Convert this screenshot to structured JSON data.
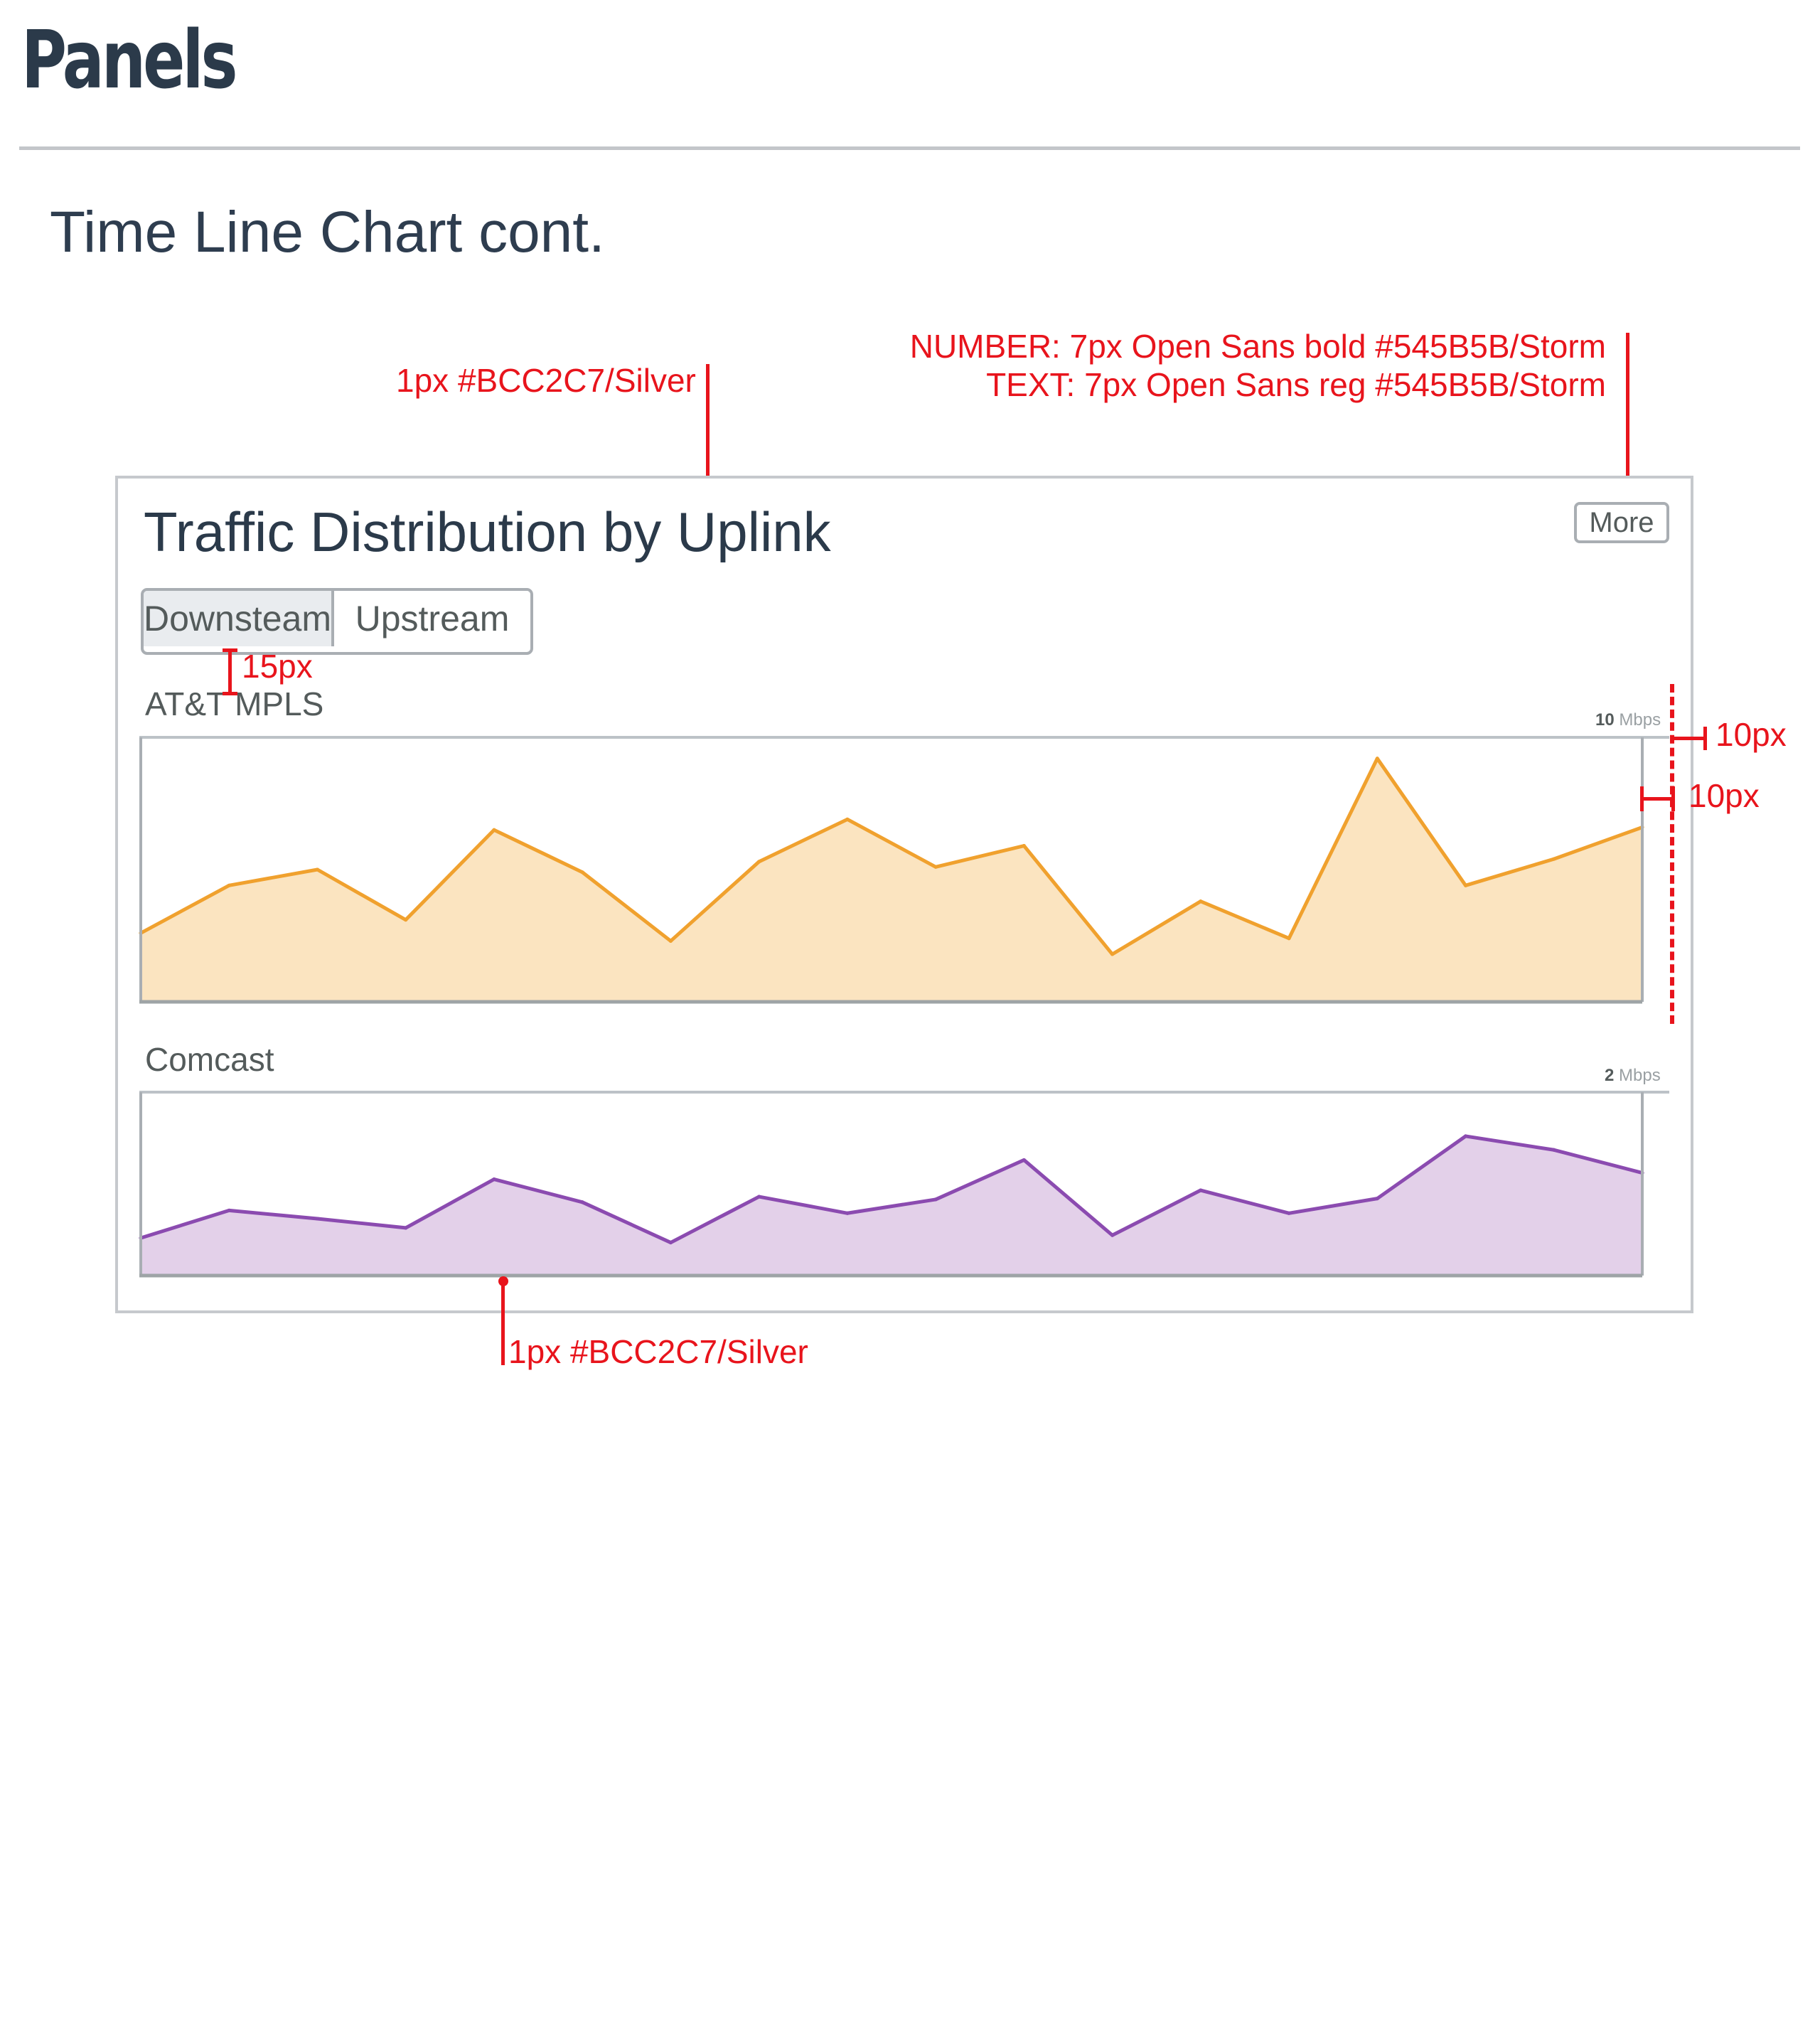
{
  "page": {
    "title": "Panels",
    "section_title": "Time Line Chart cont."
  },
  "panel": {
    "title": "Traffic Distribution by Uplink",
    "more_label": "More",
    "tabs": [
      {
        "label": "Downsteam",
        "active": true
      },
      {
        "label": "Upstream",
        "active": false
      }
    ]
  },
  "annotations": {
    "border_top": "1px #BCC2C7/Silver",
    "number_spec": "NUMBER: 7px Open Sans bold #545B5B/Storm",
    "text_spec": "TEXT: 7px Open Sans reg #545B5B/Storm",
    "spacing_label": "15px",
    "right_padding": "10px",
    "right_margin": "10px",
    "border_bottom": "1px #BCC2C7/Silver"
  },
  "colors": {
    "silver": "#BCC2C7",
    "storm": "#545B5B",
    "annotation": "#E8141C",
    "att_line": "#F0A12E",
    "att_fill": "#FBE4C0",
    "comcast_line": "#8B4BB0",
    "comcast_fill": "#E3D0E9"
  },
  "chart_data": [
    {
      "type": "area",
      "title": "AT&T MPLS",
      "scale_number": "10",
      "scale_unit": "Mbps",
      "ylim": [
        0,
        10
      ],
      "x": [
        0,
        1,
        2,
        3,
        4,
        5,
        6,
        7,
        8,
        9,
        10,
        11,
        12,
        13,
        14,
        15,
        16,
        17
      ],
      "values": [
        2.6,
        4.4,
        5.0,
        3.1,
        6.5,
        4.9,
        2.3,
        5.3,
        6.9,
        5.1,
        5.9,
        1.8,
        3.8,
        2.4,
        9.2,
        4.4,
        5.4,
        6.6
      ],
      "series": [
        {
          "color": "#F0A12E"
        }
      ]
    },
    {
      "type": "area",
      "title": "Comcast",
      "scale_number": "2",
      "scale_unit": "Mbps",
      "ylim": [
        0,
        2
      ],
      "x": [
        0,
        1,
        2,
        3,
        4,
        5,
        6,
        7,
        8,
        9,
        10,
        11,
        12,
        13,
        14,
        15,
        16,
        17
      ],
      "values": [
        0.41,
        0.71,
        0.62,
        0.52,
        1.05,
        0.8,
        0.36,
        0.86,
        0.68,
        0.83,
        1.26,
        0.44,
        0.93,
        0.68,
        0.84,
        1.52,
        1.37,
        1.12
      ],
      "series": [
        {
          "color": "#8B4BB0"
        }
      ]
    }
  ]
}
